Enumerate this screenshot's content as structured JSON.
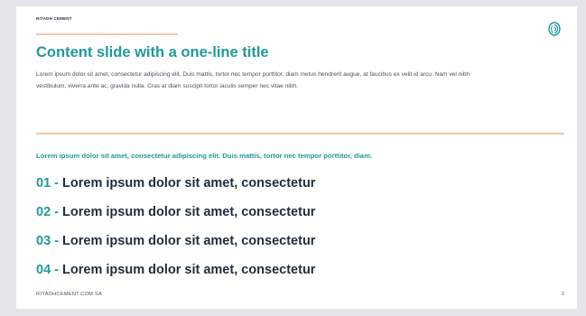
{
  "brand": "RIYADH CEMENT",
  "logo_icon": "fingerprint-leaf-icon",
  "colors": {
    "accent": "#1f9a9a",
    "rule": "#f2c8a8",
    "heading": "#1f2d3d",
    "body": "#4a5160",
    "background": "#e3e5e8"
  },
  "title": "Content slide with a one-line title",
  "intro": "Lorem ipsum dolor sit amet, consectetur adipiscing elit. Duis mattis, tortor nec tempor porttitor, diam metus hendrerit augue, at faucibus ex velit id arcu. Nam vel nibh vestibulum, viverra ante ac, gravida nulla. Cras at diam suscipit tortor iaculis semper nec vitae nibh.",
  "lead": "Lorem ipsum dolor sit amet, consectetur adipiscing elit. Duis mattis, tortor nec tempor porttitor, diam.",
  "items": [
    {
      "number": "01",
      "separator": "-",
      "text": "Lorem ipsum dolor sit amet, consectetur"
    },
    {
      "number": "02",
      "separator": "-",
      "text": "Lorem ipsum dolor sit amet, consectetur"
    },
    {
      "number": "03",
      "separator": "-",
      "text": "Lorem ipsum dolor sit amet, consectetur"
    },
    {
      "number": "04",
      "separator": "-",
      "text": "Lorem ipsum dolor sit amet, consectetur"
    }
  ],
  "footer": {
    "url": "RIYADHCEMENT.COM.SA",
    "page": "2"
  }
}
